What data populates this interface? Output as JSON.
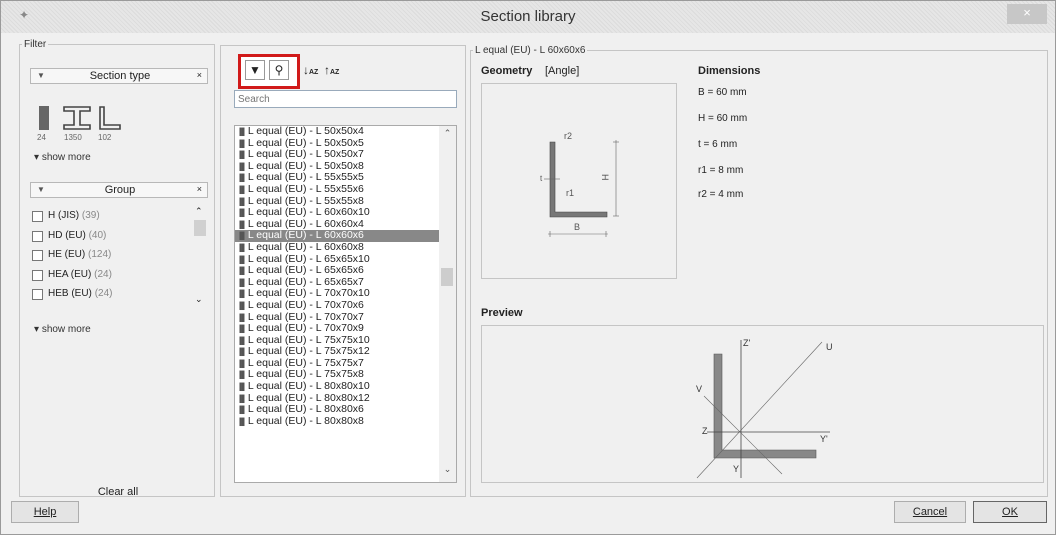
{
  "window": {
    "title": "Section library",
    "close_label": "×"
  },
  "filter": {
    "legend": "Filter",
    "section_type_label": "Section type",
    "section_type_clear": "×",
    "section_type_counts": [
      "24",
      "1350",
      "102"
    ],
    "show_more_1": "show more",
    "group_label": "Group",
    "group_clear": "×",
    "groups": [
      {
        "name": "H (JIS)",
        "count": "(39)"
      },
      {
        "name": "HD (EU)",
        "count": "(40)"
      },
      {
        "name": "HE (EU)",
        "count": "(124)"
      },
      {
        "name": "HEA (EU)",
        "count": "(24)"
      },
      {
        "name": "HEB (EU)",
        "count": "(24)"
      }
    ],
    "show_more_2": "show more",
    "clear_all": "Clear all"
  },
  "list": {
    "search_placeholder": "Search",
    "items": [
      "L equal (EU) - L 50x50x4",
      "L equal (EU) - L 50x50x5",
      "L equal (EU) - L 50x50x7",
      "L equal (EU) - L 50x50x8",
      "L equal (EU) - L 55x55x5",
      "L equal (EU) - L 55x55x6",
      "L equal (EU) - L 55x55x8",
      "L equal (EU) - L 60x60x10",
      "L equal (EU) - L 60x60x4",
      "L equal (EU) - L 60x60x6",
      "L equal (EU) - L 60x60x8",
      "L equal (EU) - L 65x65x10",
      "L equal (EU) - L 65x65x6",
      "L equal (EU) - L 65x65x7",
      "L equal (EU) - L 70x70x10",
      "L equal (EU) - L 70x70x6",
      "L equal (EU) - L 70x70x7",
      "L equal (EU) - L 70x70x9",
      "L equal (EU) - L 75x75x10",
      "L equal (EU) - L 75x75x12",
      "L equal (EU) - L 75x75x7",
      "L equal (EU) - L 75x75x8",
      "L equal (EU) - L 80x80x10",
      "L equal (EU) - L 80x80x12",
      "L equal (EU) - L 80x80x6",
      "L equal (EU) - L 80x80x8"
    ],
    "selected_item": "L equal (EU) - L 60x60x6"
  },
  "detail": {
    "legend": "L equal (EU) - L 60x60x6",
    "geometry_title": "Geometry",
    "geometry_type": "[Angle]",
    "dimensions_title": "Dimensions",
    "dimensions": [
      "B = 60 mm",
      "H = 60 mm",
      "t = 6 mm",
      "r1 = 8 mm",
      "r2 = 4 mm"
    ],
    "geom_labels": {
      "r2": "r2",
      "r1": "r1",
      "t": "t",
      "H": "H",
      "B": "B"
    },
    "preview_title": "Preview",
    "axis_labels": {
      "z_top": "Z'",
      "u": "U",
      "v": "V",
      "z": "Z",
      "y_right": "Y'",
      "y_bottom": "Y"
    }
  },
  "buttons": {
    "help": "Help",
    "cancel": "Cancel",
    "ok": "OK"
  }
}
